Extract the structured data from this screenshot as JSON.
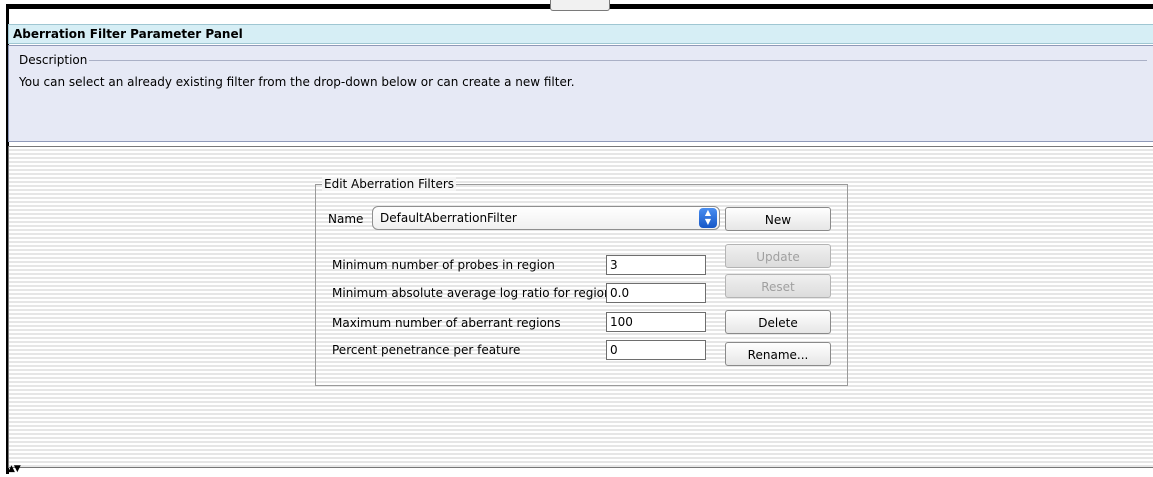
{
  "panel": {
    "title": "Aberration Filter Parameter Panel"
  },
  "description": {
    "legend": "Description",
    "text": "You can select an already existing filter from the drop-down below or can create a new filter."
  },
  "editor": {
    "legend": "Edit Aberration Filters",
    "name_label": "Name",
    "name_selected": "DefaultAberrationFilter",
    "fields": [
      {
        "label": "Minimum number of probes in region",
        "value": "3"
      },
      {
        "label": "Minimum absolute average log ratio for region",
        "value": "0.0"
      },
      {
        "label": "Maximum number of aberrant regions",
        "value": "100"
      },
      {
        "label": "Percent penetrance per feature",
        "value": "0"
      }
    ],
    "buttons": {
      "new": "New",
      "update": "Update",
      "reset": "Reset",
      "delete": "Delete",
      "rename": "Rename..."
    }
  },
  "icons": {
    "select_arrow": "up-down-chevron-icon",
    "scroll_arrows": "up-down-arrow-icon"
  }
}
